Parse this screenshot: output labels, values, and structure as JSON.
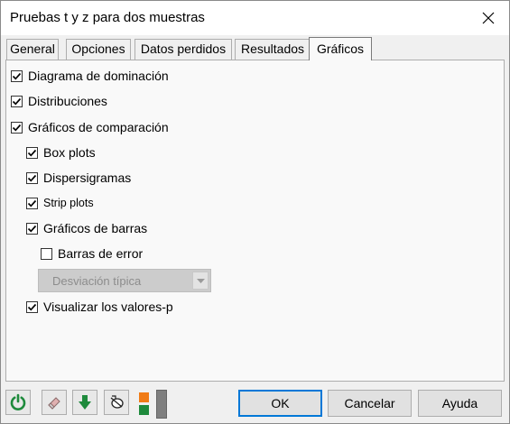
{
  "window": {
    "title": "Pruebas t y z para dos muestras"
  },
  "tabs": [
    {
      "label": "General"
    },
    {
      "label": "Opciones"
    },
    {
      "label": "Datos perdidos"
    },
    {
      "label": "Resultados"
    },
    {
      "label": "Gráficos",
      "active": true
    }
  ],
  "options": {
    "diagrama_dominacion": {
      "label": "Diagrama de dominación",
      "checked": true
    },
    "distribuciones": {
      "label": "Distribuciones",
      "checked": true
    },
    "graficos_comparacion": {
      "label": "Gráficos de comparación",
      "checked": true
    },
    "box_plots": {
      "label": "Box plots",
      "checked": true
    },
    "dispersigramas": {
      "label": "Dispersigramas",
      "checked": true
    },
    "strip_plots": {
      "label": "Strip plots",
      "checked": true
    },
    "graficos_barras": {
      "label": "Gráficos de barras",
      "checked": true
    },
    "barras_error": {
      "label": "Barras de error",
      "checked": false
    },
    "valores_p": {
      "label": "Visualizar los valores-p",
      "checked": true
    }
  },
  "error_type": {
    "selected": "Desviación típica",
    "disabled": true
  },
  "toolbar": {
    "reset_icon": "circular-arrow-icon",
    "eraser_icon": "eraser-icon",
    "download_icon": "down-arrow-icon",
    "clear_icon": "cursor-icon",
    "colors": {
      "orange": "#f07b16",
      "green": "#1e8a3c"
    }
  },
  "buttons": {
    "ok": "OK",
    "cancel": "Cancelar",
    "help": "Ayuda"
  },
  "colors": {
    "accent": "#0078d7",
    "panel": "#f9f9f9",
    "window": "#f0f0f0"
  }
}
